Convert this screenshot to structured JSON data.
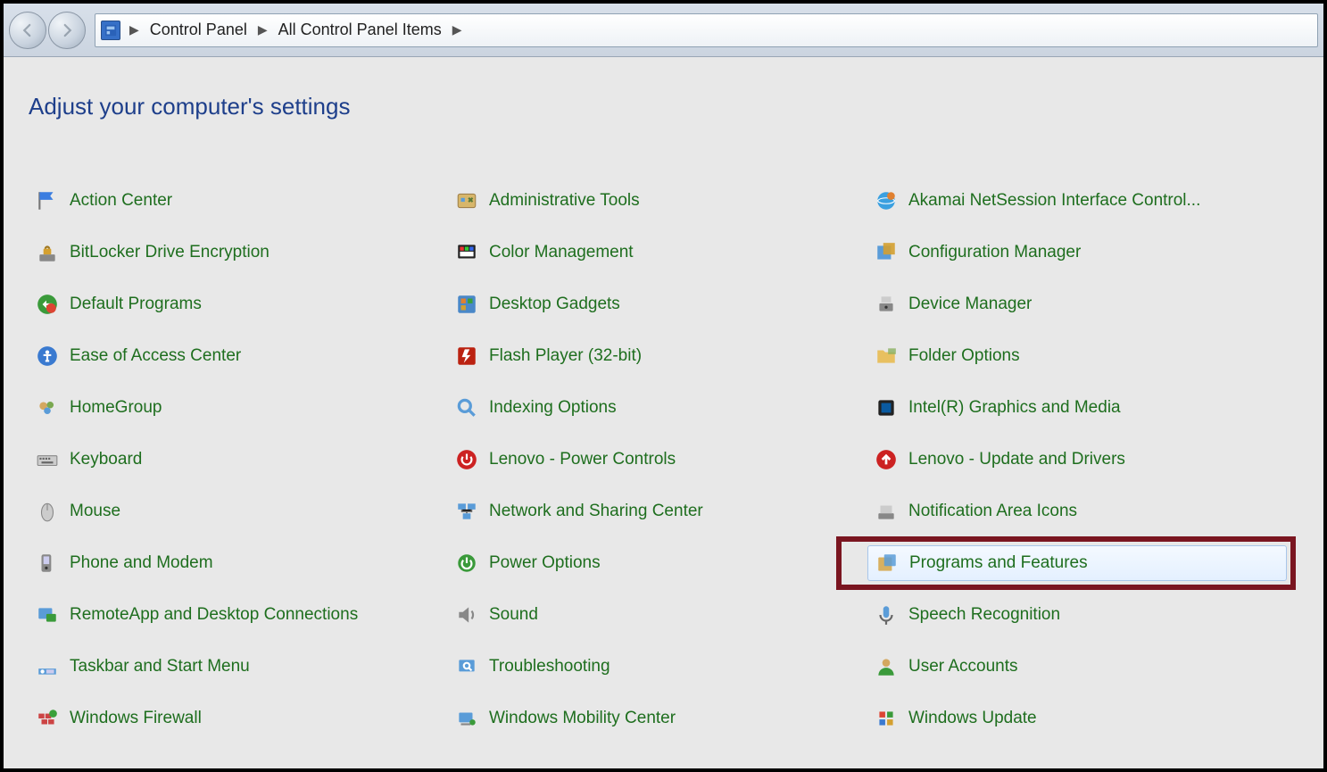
{
  "breadcrumb": {
    "root_chevron": "▶",
    "segments": [
      "Control Panel",
      "All Control Panel Items"
    ]
  },
  "heading": "Adjust your computer's settings",
  "items": [
    {
      "label": "Action Center",
      "icon": "flag-icon"
    },
    {
      "label": "Administrative Tools",
      "icon": "tools-icon"
    },
    {
      "label": "Akamai NetSession Interface Control...",
      "icon": "globe-icon"
    },
    {
      "label": "BitLocker Drive Encryption",
      "icon": "lock-drive-icon"
    },
    {
      "label": "Color Management",
      "icon": "color-icon"
    },
    {
      "label": "Configuration Manager",
      "icon": "config-icon"
    },
    {
      "label": "Default Programs",
      "icon": "default-prog-icon"
    },
    {
      "label": "Desktop Gadgets",
      "icon": "gadgets-icon"
    },
    {
      "label": "Device Manager",
      "icon": "device-icon"
    },
    {
      "label": "Ease of Access Center",
      "icon": "ease-access-icon"
    },
    {
      "label": "Flash Player (32-bit)",
      "icon": "flash-icon"
    },
    {
      "label": "Folder Options",
      "icon": "folder-icon"
    },
    {
      "label": "HomeGroup",
      "icon": "homegroup-icon"
    },
    {
      "label": "Indexing Options",
      "icon": "indexing-icon"
    },
    {
      "label": "Intel(R) Graphics and Media",
      "icon": "intel-icon"
    },
    {
      "label": "Keyboard",
      "icon": "keyboard-icon"
    },
    {
      "label": "Lenovo - Power Controls",
      "icon": "lenovo-power-icon"
    },
    {
      "label": "Lenovo - Update and Drivers",
      "icon": "lenovo-update-icon"
    },
    {
      "label": "Mouse",
      "icon": "mouse-icon"
    },
    {
      "label": "Network and Sharing Center",
      "icon": "network-icon"
    },
    {
      "label": "Notification Area Icons",
      "icon": "notification-icon"
    },
    {
      "label": "Phone and Modem",
      "icon": "phone-icon"
    },
    {
      "label": "Power Options",
      "icon": "power-icon"
    },
    {
      "label": "Programs and Features",
      "icon": "programs-icon",
      "highlighted": true
    },
    {
      "label": "RemoteApp and Desktop Connections",
      "icon": "remoteapp-icon"
    },
    {
      "label": "Sound",
      "icon": "sound-icon"
    },
    {
      "label": "Speech Recognition",
      "icon": "speech-icon"
    },
    {
      "label": "Taskbar and Start Menu",
      "icon": "taskbar-icon"
    },
    {
      "label": "Troubleshooting",
      "icon": "troubleshoot-icon"
    },
    {
      "label": "User Accounts",
      "icon": "user-icon"
    },
    {
      "label": "Windows Firewall",
      "icon": "firewall-icon"
    },
    {
      "label": "Windows Mobility Center",
      "icon": "mobility-icon"
    },
    {
      "label": "Windows Update",
      "icon": "update-icon"
    }
  ]
}
